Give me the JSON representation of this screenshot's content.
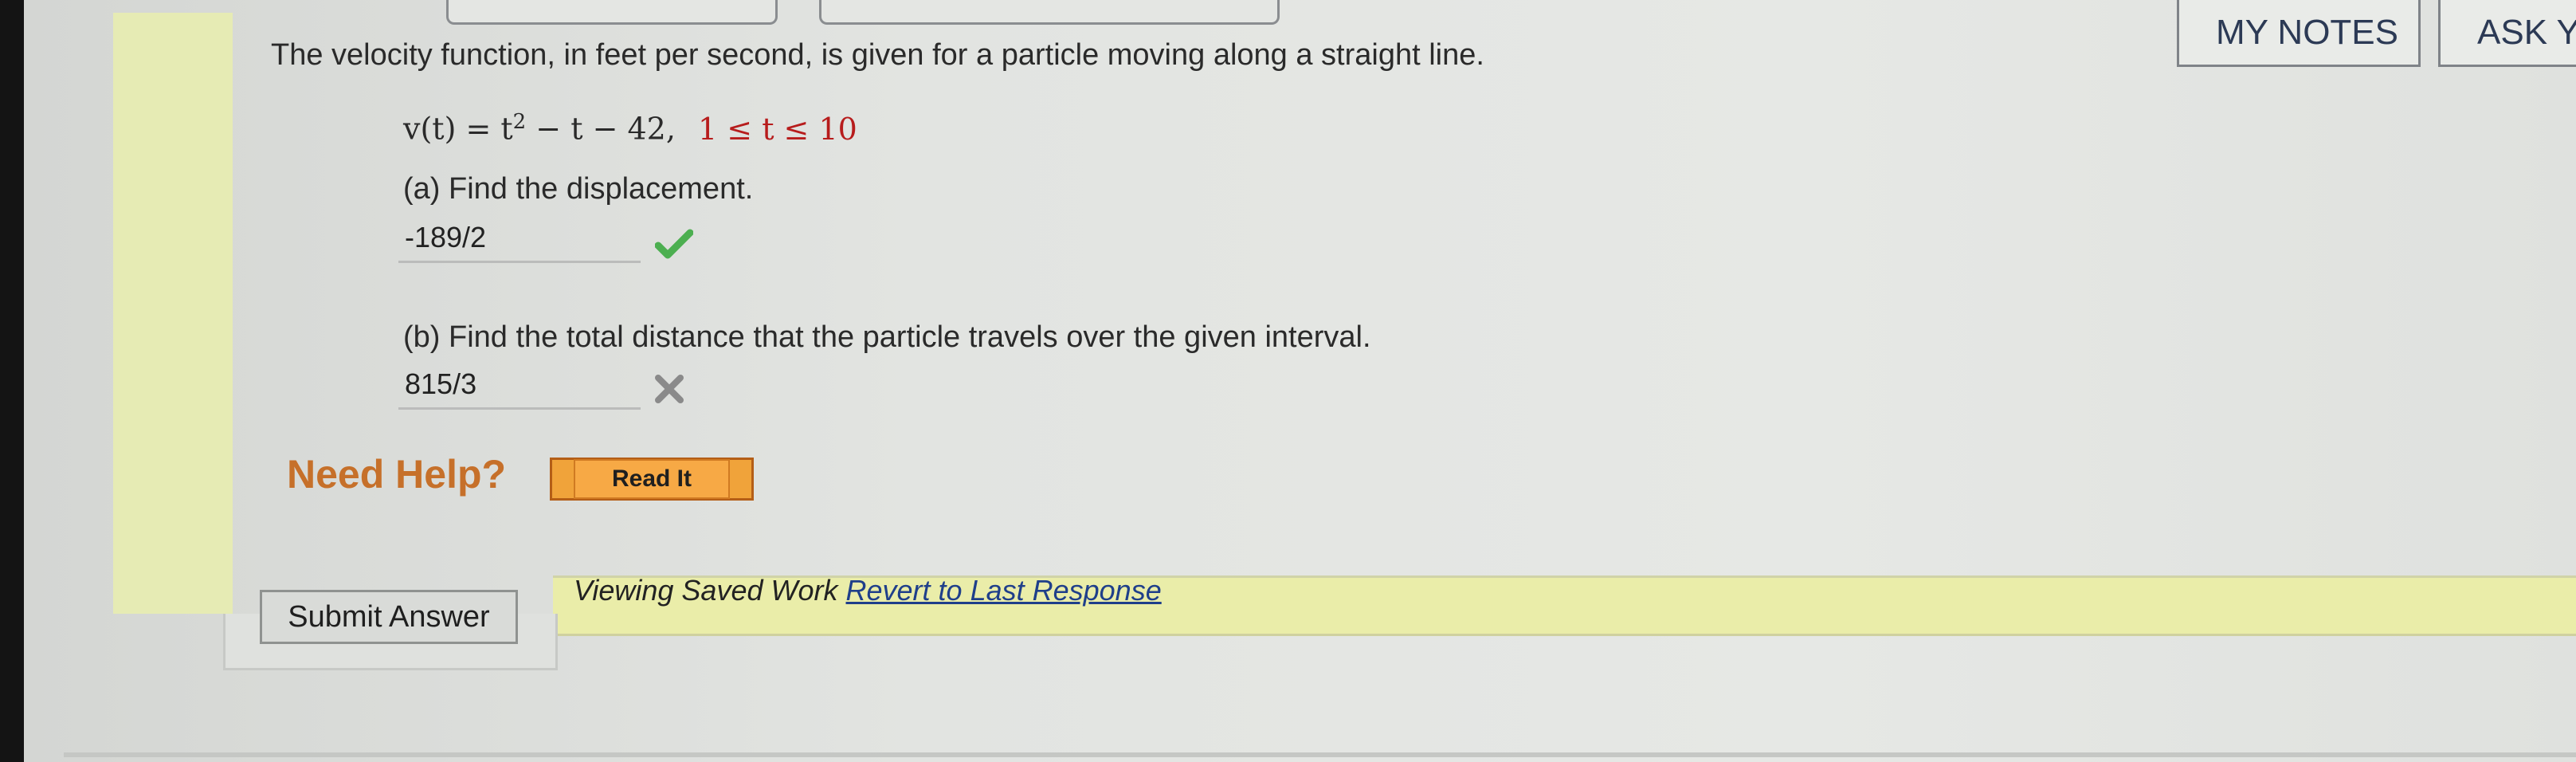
{
  "header": {
    "my_notes": "MY NOTES",
    "ask_your": "ASK YC"
  },
  "question": {
    "intro": "The velocity function, in feet per second, is given for a particle moving along a straight line.",
    "function_lhs": "v(t) = t",
    "function_exp": "2",
    "function_rhs": " − t − 42,",
    "function_domain": "1 ≤ t ≤ 10",
    "part_a_prompt": "(a) Find the displacement.",
    "part_a_answer": "-189/2",
    "part_a_status": "correct",
    "part_b_prompt": "(b) Find the total distance that the particle travels over the given interval.",
    "part_b_answer": "815/3",
    "part_b_status": "incorrect"
  },
  "help": {
    "label": "Need Help?",
    "read_it": "Read It"
  },
  "footer": {
    "submit": "Submit Answer",
    "viewing": "Viewing Saved Work",
    "revert": "Revert to Last Response"
  },
  "colors": {
    "accent_green": "#4caf50",
    "error_gray": "#8a8a8a",
    "help_orange": "#c6702a"
  }
}
